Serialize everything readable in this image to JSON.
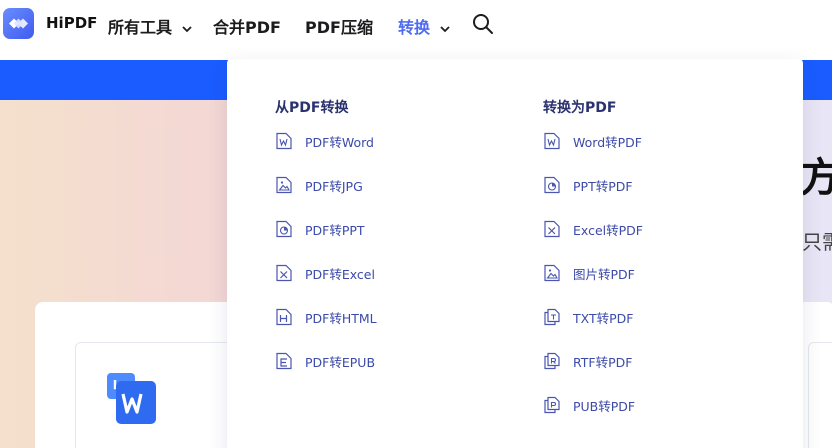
{
  "brand": {
    "name": "HiPDF"
  },
  "nav": {
    "all_tools": "所有工具",
    "merge": "合并PDF",
    "compress": "PDF压缩",
    "convert": "转换",
    "active_color": "#4f6cf0"
  },
  "icons": {
    "logo": "hipdf-logo-icon",
    "search": "search-icon",
    "chevron": "chevron-down-icon",
    "word_tool": "pdf-to-word-icon"
  },
  "hero": {
    "heading": "方",
    "subtext": "只需",
    "band_color": "#1a5cff"
  },
  "dropdown": {
    "from_pdf": {
      "title": "从PDF转换",
      "items": [
        {
          "label": "PDF转Word",
          "icon": "word-doc-icon"
        },
        {
          "label": "PDF转JPG",
          "icon": "image-doc-icon"
        },
        {
          "label": "PDF转PPT",
          "icon": "ppt-doc-icon"
        },
        {
          "label": "PDF转Excel",
          "icon": "excel-doc-icon"
        },
        {
          "label": "PDF转HTML",
          "icon": "html-doc-icon"
        },
        {
          "label": "PDF转EPUB",
          "icon": "epub-doc-icon"
        }
      ]
    },
    "to_pdf": {
      "title": "转换为PDF",
      "items": [
        {
          "label": "Word转PDF",
          "icon": "word-doc-icon"
        },
        {
          "label": "PPT转PDF",
          "icon": "ppt-doc-icon"
        },
        {
          "label": "Excel转PDF",
          "icon": "excel-doc-icon"
        },
        {
          "label": "图片转PDF",
          "icon": "image-doc-icon"
        },
        {
          "label": "TXT转PDF",
          "icon": "txt-doc-icon"
        },
        {
          "label": "RTF转PDF",
          "icon": "rtf-doc-icon"
        },
        {
          "label": "PUB转PDF",
          "icon": "pub-doc-icon"
        }
      ]
    }
  }
}
